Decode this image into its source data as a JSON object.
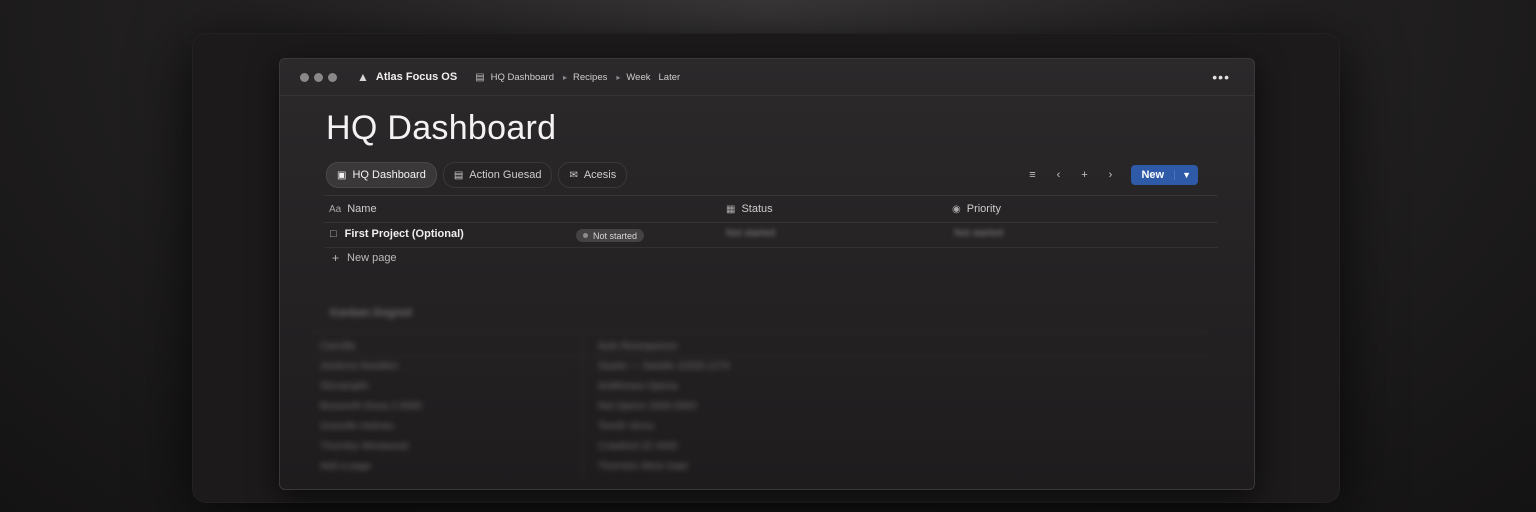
{
  "window": {
    "app_name": "Atlas Focus OS",
    "breadcrumbs": [
      "HQ Dashboard",
      "Recipes",
      "Week",
      "Later"
    ],
    "more_icon": "more-horizontal-icon"
  },
  "page": {
    "title": "HQ Dashboard"
  },
  "tabs": [
    {
      "label": "HQ Dashboard",
      "icon": "gallery-icon",
      "active": true
    },
    {
      "label": "Action Guesad",
      "icon": "table-icon",
      "active": false
    },
    {
      "label": "Acesis",
      "icon": "inbox-icon",
      "active": false
    }
  ],
  "toolbar": {
    "new_label": "New"
  },
  "table": {
    "columns": [
      {
        "label": "Name",
        "icon": "text-icon"
      },
      {
        "label": "Status",
        "icon": "status-icon"
      },
      {
        "label": "Priority",
        "icon": "priority-icon"
      }
    ],
    "rows": [
      {
        "name": "First Project (Optional)",
        "status_badge": "Not started",
        "status": "Not started",
        "priority": "Not started"
      }
    ],
    "new_page_label": "New page"
  },
  "blurred_section": {
    "title": "Kanban Dogred",
    "left_items": [
      "Carrolla",
      "Jonterra Hewitten",
      "Slovamplin",
      "Bosworth Dona 2.0000",
      "Gravelle Holmes",
      "Thornley Westwood",
      "Add a page"
    ],
    "right_items": [
      "Auto Resequence",
      "Searle — Swistle 22000.1274",
      "Antitheses Opena",
      "Not Openn 2000.0000",
      "Tereth Verso",
      "Crawford 22 4400",
      "Thornton West Gaar"
    ]
  },
  "colors": {
    "accent": "#2e5aa8",
    "background": "#1c1a1b",
    "badge": "#454243"
  }
}
